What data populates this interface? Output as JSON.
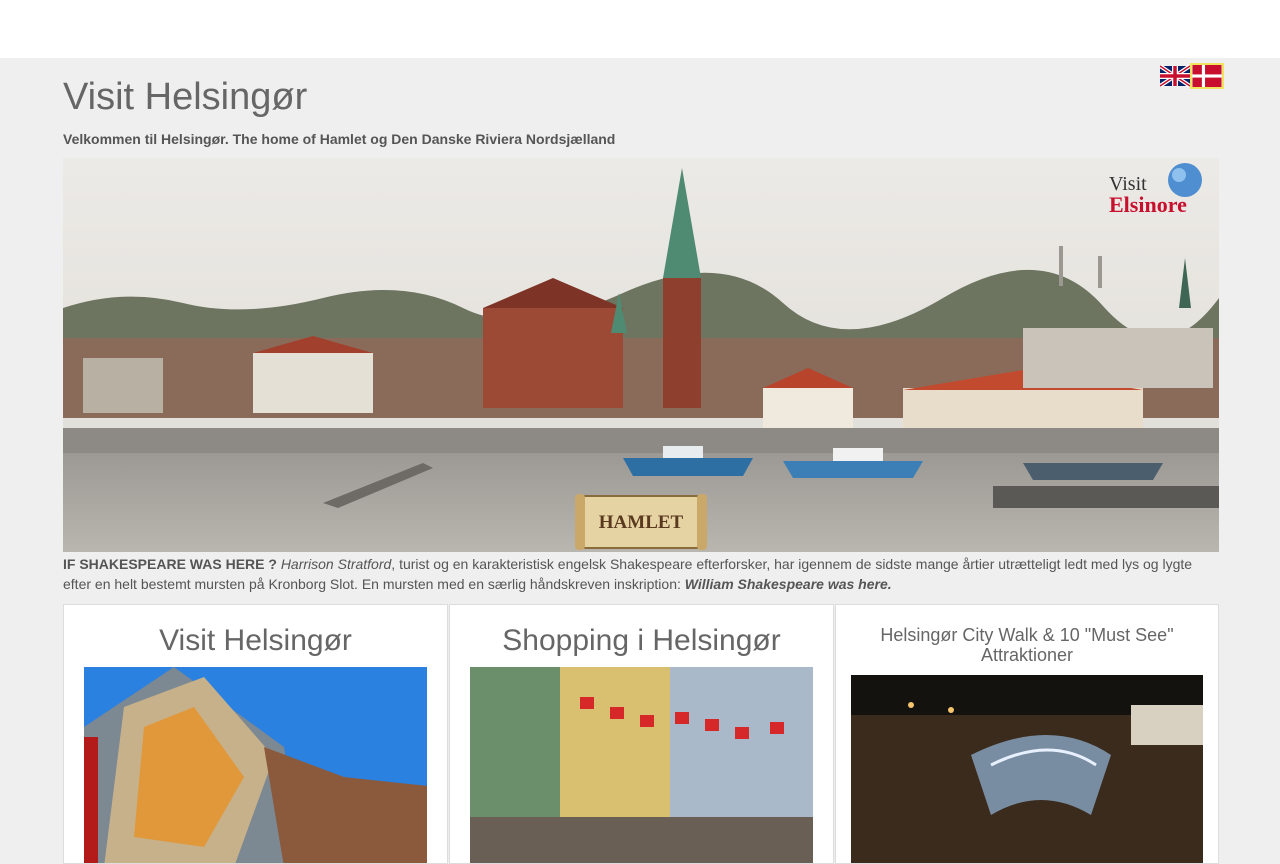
{
  "header": {
    "title": "Visit Helsingør",
    "subtitle": "Velkommen til Helsingør. The home of Hamlet og Den Danske Riviera Nordsjælland",
    "languages": [
      {
        "name": "English",
        "icon": "uk-flag-icon"
      },
      {
        "name": "Dansk",
        "icon": "danish-flag-icon"
      }
    ]
  },
  "hero": {
    "logo_text_1": "Visit",
    "logo_text_2": "Elsinore",
    "badge_text": "HAMLET"
  },
  "intro": {
    "lead": "IF SHAKESPEARE WAS HERE ?",
    "author": "Harrison Stratford",
    "text": ", turist og en karakteristisk engelsk Shakespeare efterforsker, har igennem de sidste mange årtier utrætteligt ledt med lys og lygte efter en helt bestemt mursten på Kronborg Slot. En mursten med en særlig håndskreven inskription: ",
    "inscription": "William Shakespeare was here."
  },
  "cards": [
    {
      "title": "Visit Helsingør"
    },
    {
      "title": "Shopping i Helsingør"
    },
    {
      "title": "Helsingør City Walk & 10 \"Must See\" Attraktioner"
    }
  ],
  "colors": {
    "background": "#efefef",
    "text": "#555555",
    "logo_red": "#c8102e"
  }
}
